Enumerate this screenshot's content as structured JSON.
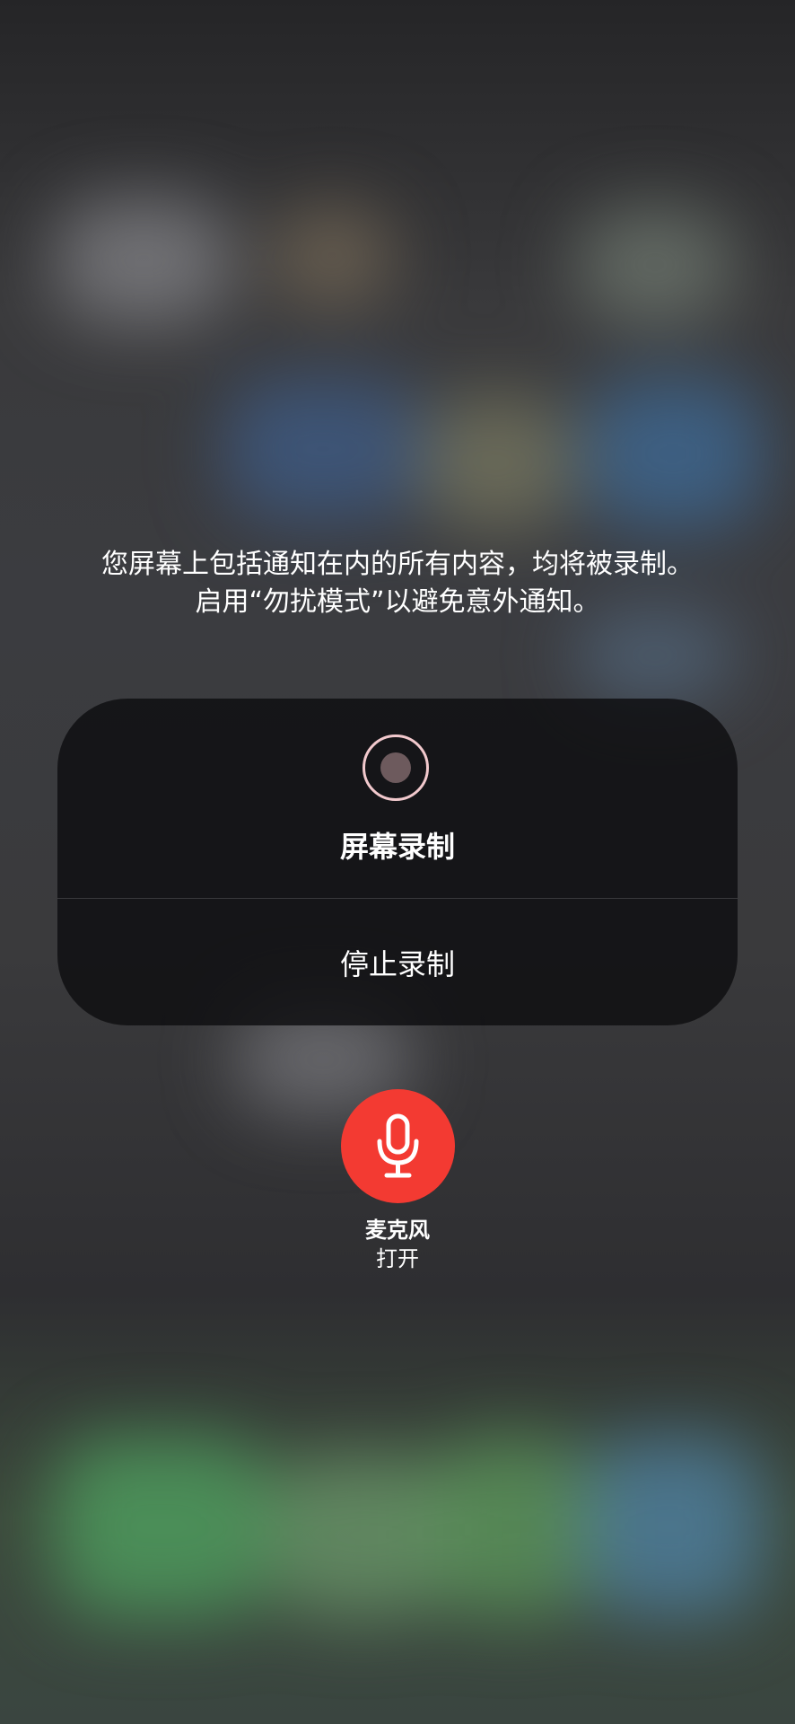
{
  "notice": {
    "line1": "您屏幕上包括通知在内的所有内容，均将被录制。",
    "line2": "启用“勿扰模式”以避免意外通知。"
  },
  "record_panel": {
    "title": "屏幕录制",
    "stop_label": "停止录制",
    "record_icon": "record-icon"
  },
  "microphone": {
    "label": "麦克风",
    "status": "打开",
    "icon": "microphone-icon",
    "accent_color": "#f33a32"
  }
}
